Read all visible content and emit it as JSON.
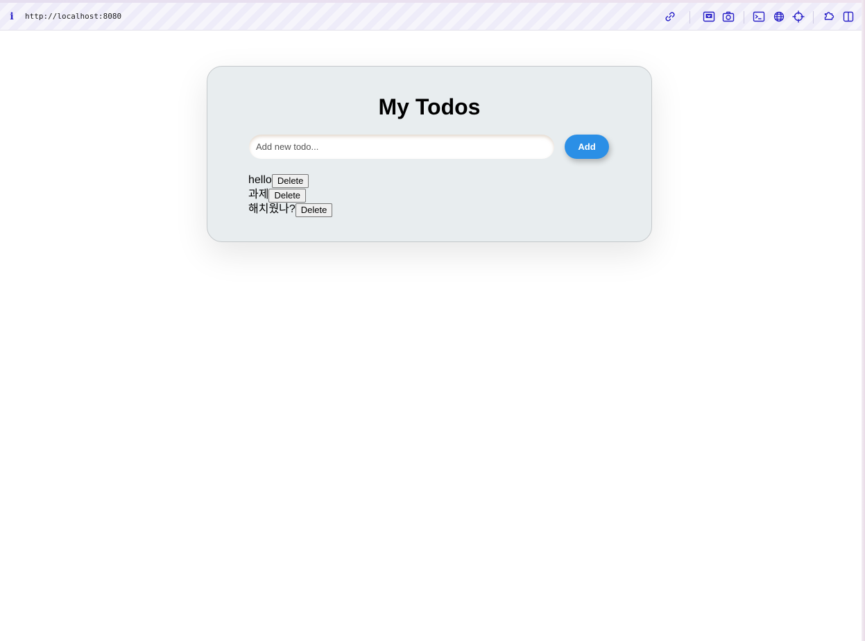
{
  "browser": {
    "url": "http://localhost:8080",
    "toolbar_icons": [
      "link-icon",
      "save-page-icon",
      "camera-icon",
      "terminal-icon",
      "globe-icon",
      "crosshair-icon",
      "extension-icon",
      "split-view-icon"
    ],
    "icon_color": "#2a22c8"
  },
  "app": {
    "title": "My Todos",
    "input_placeholder": "Add new todo...",
    "input_value": "",
    "add_label": "Add",
    "accent_color": "#2b8fe6",
    "card_color": "#e8edef",
    "todos": [
      {
        "text": "hello",
        "delete_label": "Delete"
      },
      {
        "text": "과제",
        "delete_label": "Delete"
      },
      {
        "text": "해치웠나?",
        "delete_label": "Delete"
      }
    ]
  }
}
